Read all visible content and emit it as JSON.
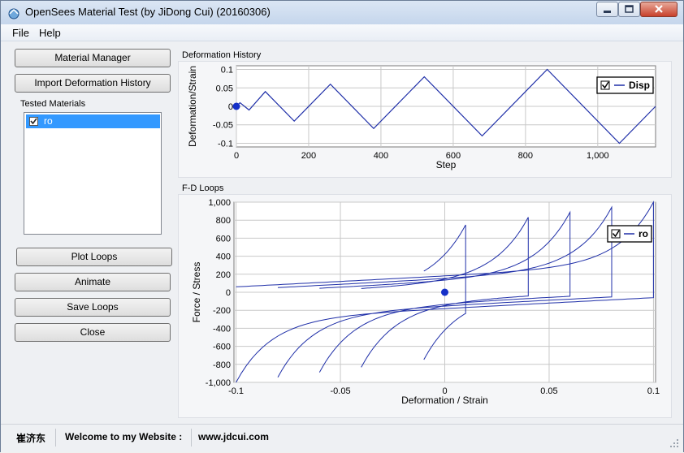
{
  "window": {
    "title": "OpenSees Material Test (by JiDong Cui) (20160306)"
  },
  "menu": [
    {
      "label": "File"
    },
    {
      "label": "Help"
    }
  ],
  "buttons": {
    "material_manager": "Material Manager",
    "import_history": "Import Deformation History",
    "plot_loops": "Plot Loops",
    "animate": "Animate",
    "save_loops": "Save Loops",
    "close": "Close"
  },
  "tested_materials": {
    "label": "Tested Materials",
    "items": [
      {
        "label": "ro",
        "checked": true,
        "selected": true
      }
    ]
  },
  "panels": {
    "history_label": "Deformation History",
    "loops_label": "F-D Loops"
  },
  "status": {
    "name": "崔济东",
    "welcome": "Welcome to my Website :",
    "url": "www.jdcui.com"
  },
  "colors": {
    "series": "#1f2fa8",
    "marker": "#1530c8",
    "grid": "#c8c8c8"
  },
  "chart_data": [
    {
      "type": "line",
      "title": "",
      "xlabel": "Step",
      "ylabel": "Deformation/Strain",
      "xlim": [
        0,
        1160
      ],
      "ylim": [
        -0.11,
        0.11
      ],
      "xticks": [
        0,
        200,
        400,
        600,
        800,
        1000
      ],
      "xtick_labels": [
        "0",
        "200",
        "400",
        "600",
        "800",
        "1,000"
      ],
      "yticks": [
        0.1,
        0.05,
        0,
        -0.05,
        -0.1
      ],
      "ytick_labels": [
        "0.1",
        "0.05",
        "0",
        "-0.05",
        "-0.1"
      ],
      "grid": true,
      "legend": "top-right",
      "series": [
        {
          "name": "Disp",
          "x": [
            0,
            10,
            35,
            80,
            160,
            260,
            380,
            520,
            680,
            860,
            1060,
            1160
          ],
          "y": [
            0,
            0.01,
            -0.01,
            0.04,
            -0.04,
            0.06,
            -0.06,
            0.08,
            -0.08,
            0.1,
            -0.1,
            0.0
          ]
        }
      ],
      "marker": {
        "x": 0,
        "y": 0
      }
    },
    {
      "type": "line",
      "title": "",
      "xlabel": "Deformation / Strain",
      "ylabel": "Force / Stress",
      "xlim": [
        -0.101,
        0.101
      ],
      "ylim": [
        -1000,
        1000
      ],
      "xticks": [
        -0.1,
        -0.05,
        0,
        0.05,
        0.1
      ],
      "xtick_labels": [
        "-0.1",
        "-0.05",
        "0",
        "0.05",
        "0.1"
      ],
      "yticks": [
        1000,
        800,
        600,
        400,
        200,
        0,
        -200,
        -400,
        -600,
        -800,
        -1000
      ],
      "ytick_labels": [
        "1,000",
        "800",
        "600",
        "400",
        "200",
        "0",
        "-200",
        "-400",
        "-600",
        "-800",
        "-1,000"
      ],
      "grid": true,
      "legend": "top-right",
      "series": [
        {
          "name": "ro",
          "loop_amplitudes": [
            0.01,
            0.04,
            0.06,
            0.08,
            0.1
          ]
        }
      ],
      "marker": {
        "x": 0,
        "y": 0
      }
    }
  ]
}
